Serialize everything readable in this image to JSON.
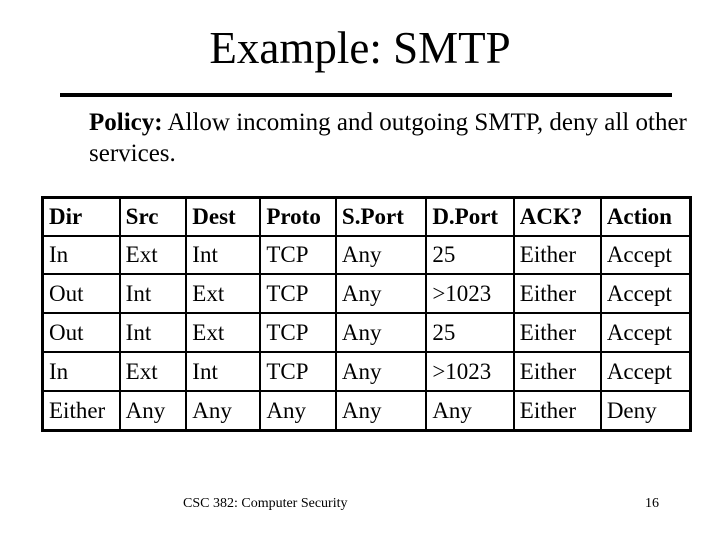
{
  "slide": {
    "title": "Example: SMTP",
    "policy": {
      "label": "Policy:",
      "text": " Allow incoming and outgoing SMTP, deny all other services."
    },
    "table": {
      "headers": [
        "Dir",
        "Src",
        "Dest",
        "Proto",
        "S.Port",
        "D.Port",
        "ACK?",
        "Action"
      ],
      "rows": [
        [
          "In",
          "Ext",
          "Int",
          "TCP",
          "Any",
          "25",
          "Either",
          "Accept"
        ],
        [
          "Out",
          "Int",
          "Ext",
          "TCP",
          "Any",
          ">1023",
          "Either",
          "Accept"
        ],
        [
          "Out",
          "Int",
          "Ext",
          "TCP",
          "Any",
          "25",
          "Either",
          "Accept"
        ],
        [
          "In",
          "Ext",
          "Int",
          "TCP",
          "Any",
          ">1023",
          "Either",
          "Accept"
        ],
        [
          "Either",
          "Any",
          "Any",
          "Any",
          "Any",
          "Any",
          "Either",
          "Deny"
        ]
      ]
    },
    "footer": {
      "course": "CSC 382: Computer Security",
      "page_number": "16"
    }
  }
}
